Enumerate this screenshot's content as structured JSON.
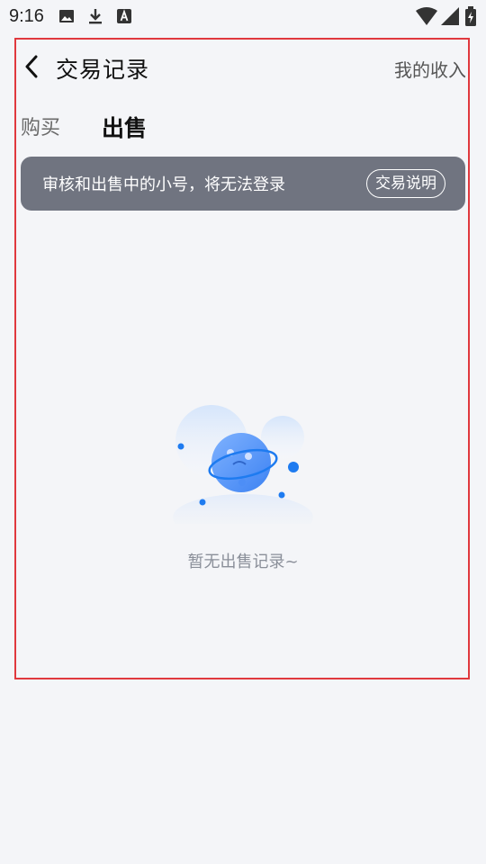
{
  "status_bar": {
    "time": "9:16",
    "icons": [
      "image-icon",
      "download-icon",
      "font-icon"
    ],
    "right_icons": [
      "wifi-icon",
      "signal-icon",
      "battery-icon"
    ]
  },
  "header": {
    "title": "交易记录",
    "income_link": "我的收入"
  },
  "tabs": [
    {
      "label": "购买",
      "active": false
    },
    {
      "label": "出售",
      "active": true
    }
  ],
  "notice": {
    "text": "审核和出售中的小号，将无法登录",
    "button_label": "交易说明",
    "bg_color": "#707480"
  },
  "empty_state": {
    "text": "暂无出售记录~",
    "icon": "sad-planet-icon"
  },
  "colors": {
    "frame": "#e0393e",
    "background": "#f4f5f8",
    "accent_blue": "#1e7bf0"
  }
}
